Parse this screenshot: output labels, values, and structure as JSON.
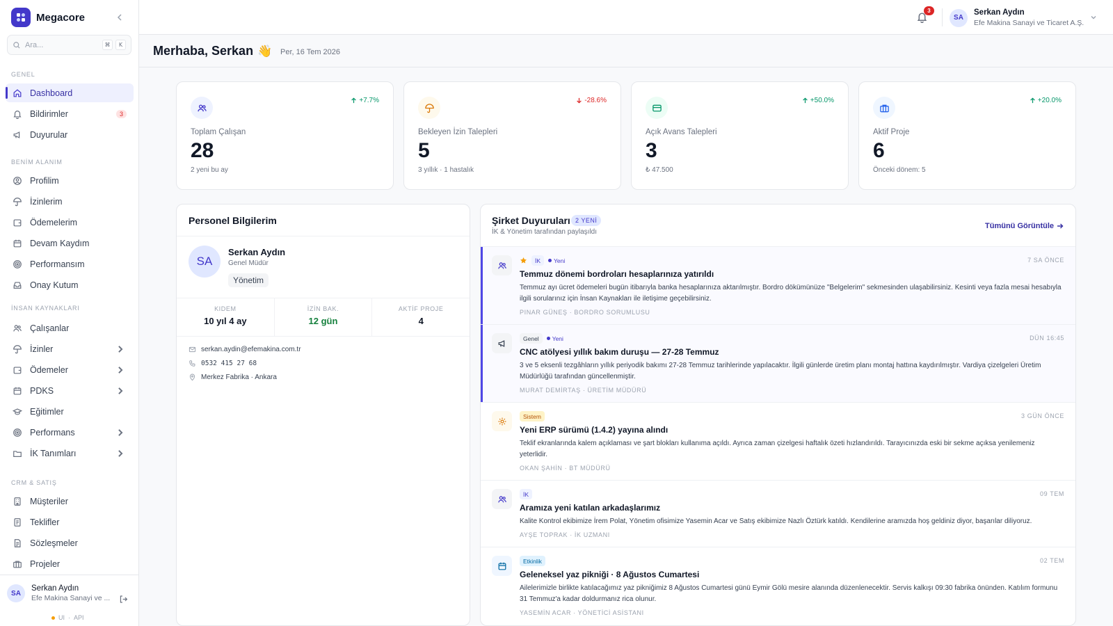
{
  "app": {
    "name": "Megacore"
  },
  "search": {
    "placeholder": "Ara...",
    "kbd1": "⌘",
    "kbd2": "K"
  },
  "sidebar": {
    "sections": [
      {
        "label": "GENEL"
      },
      {
        "label": "BENİM ALANIM"
      },
      {
        "label": "İNSAN KAYNAKLARI"
      },
      {
        "label": "CRM & SATIŞ"
      }
    ],
    "items": [
      {
        "label": "Dashboard",
        "icon": "home-icon",
        "active": true
      },
      {
        "label": "Bildirimler",
        "icon": "bell-icon",
        "badge": "3"
      },
      {
        "label": "Duyurular",
        "icon": "megaphone-icon"
      },
      {
        "label": "Profilim",
        "icon": "user-circle-icon"
      },
      {
        "label": "İzinlerim",
        "icon": "umbrella-icon"
      },
      {
        "label": "Ödemelerim",
        "icon": "wallet-icon"
      },
      {
        "label": "Devam Kaydım",
        "icon": "calendar-icon"
      },
      {
        "label": "Performansım",
        "icon": "target-icon"
      },
      {
        "label": "Onay Kutum",
        "icon": "inbox-icon"
      },
      {
        "label": "Çalışanlar",
        "icon": "users-icon"
      },
      {
        "label": "İzinler",
        "icon": "umbrella-icon",
        "chevron": true
      },
      {
        "label": "Ödemeler",
        "icon": "wallet-icon",
        "chevron": true
      },
      {
        "label": "PDKS",
        "icon": "calendar-icon",
        "chevron": true
      },
      {
        "label": "Eğitimler",
        "icon": "graduation-cap-icon"
      },
      {
        "label": "Performans",
        "icon": "target-icon",
        "chevron": true
      },
      {
        "label": "İK Tanımları",
        "icon": "folder-icon",
        "chevron": true
      },
      {
        "label": "Müşteriler",
        "icon": "building-icon"
      },
      {
        "label": "Teklifler",
        "icon": "document-icon"
      },
      {
        "label": "Sözleşmeler",
        "icon": "contract-icon"
      },
      {
        "label": "Projeler",
        "icon": "briefcase-icon"
      }
    ],
    "footer": {
      "initials": "SA",
      "name": "Serkan Aydın",
      "company": "Efe Makina Sanayi ve ...",
      "env_ui": "UI",
      "env_sep": "·",
      "env_api": "API"
    }
  },
  "topbar": {
    "notification_count": "3",
    "user_initials": "SA",
    "user_name": "Serkan Aydın",
    "user_company": "Efe Makina Sanayi ve Ticaret A.Ş."
  },
  "header": {
    "greeting": "Merhaba, Serkan",
    "emoji": "👋",
    "date": "Per, 16 Tem 2026"
  },
  "stats": [
    {
      "label": "Toplam Çalışan",
      "value": "28",
      "sub": "2 yeni bu ay",
      "trend": "+7.7%",
      "direction": "up",
      "icon": "users-icon",
      "color": "#4338ca",
      "bg": "#eef2ff"
    },
    {
      "label": "Bekleyen İzin Talepleri",
      "value": "5",
      "sub": "3 yıllık · 1 hastalık",
      "trend": "-28.6%",
      "direction": "down",
      "icon": "umbrella-icon",
      "color": "#d97706",
      "bg": "#fef9ec"
    },
    {
      "label": "Açık Avans Talepleri",
      "value": "3",
      "sub": "₺ 47.500",
      "trend": "+50.0%",
      "direction": "up",
      "icon": "credit-card-icon",
      "color": "#059669",
      "bg": "#ecfdf5"
    },
    {
      "label": "Aktif Proje",
      "value": "6",
      "sub": "Önceki dönem: 5",
      "trend": "+20.0%",
      "direction": "up",
      "icon": "briefcase-icon",
      "color": "#2563eb",
      "bg": "#eff6ff"
    }
  ],
  "profile": {
    "title": "Personel Bilgilerim",
    "initials": "SA",
    "name": "Serkan Aydın",
    "role": "Genel Müdür",
    "department": "Yönetim",
    "stats": [
      {
        "label": "KIDEM",
        "value": "10 yıl 4 ay"
      },
      {
        "label": "İZİN BAK.",
        "value": "12 gün"
      },
      {
        "label": "AKTİF PROJE",
        "value": "4"
      }
    ],
    "email": "serkan.aydin@efemakina.com.tr",
    "phone": "0532 415 27 68",
    "location": "Merkez Fabrika · Ankara"
  },
  "announcements": {
    "title": "Şirket Duyuruları",
    "new_badge": "2 YENİ",
    "subtitle": "İK & Yönetim tarafından paylaşıldı",
    "view_all": "Tümünü Görüntüle",
    "items": [
      {
        "tag": "İK",
        "new": "Yeni",
        "pinned": true,
        "time": "7 SA ÖNCE",
        "title": "Temmuz dönemi bordroları hesaplarınıza yatırıldı",
        "body": "Temmuz ayı ücret ödemeleri bugün itibarıyla banka hesaplarınıza aktarılmıştır. Bordro dökümünüze \"Belgelerim\" sekmesinden ulaşabilirsiniz. Kesinti veya fazla mesai hesabıyla ilgili sorularınız için İnsan Kaynakları ile iletişime geçebilirsiniz.",
        "author": "PINAR GÜNEŞ · BORDRO SORUMLUSU",
        "icon": "users-icon"
      },
      {
        "tag": "Genel",
        "new": "Yeni",
        "time": "DÜN 16:45",
        "title": "CNC atölyesi yıllık bakım duruşu — 27-28 Temmuz",
        "body": "3 ve 5 eksenli tezgâhların yıllık periyodik bakımı 27-28 Temmuz tarihlerinde yapılacaktır. İlgili günlerde üretim planı montaj hattına kaydırılmıştır. Vardiya çizelgeleri Üretim Müdürlüğü tarafından güncellenmiştir.",
        "author": "MURAT DEMİRTAŞ · ÜRETİM MÜDÜRÜ",
        "icon": "megaphone-icon"
      },
      {
        "tag": "Sistem",
        "time": "3 GÜN ÖNCE",
        "title": "Yeni ERP sürümü (1.4.2) yayına alındı",
        "body": "Teklif ekranlarında kalem açıklaması ve şart blokları kullanıma açıldı. Ayrıca zaman çizelgesi haftalık özeti hızlandırıldı. Tarayıcınızda eski bir sekme açıksa yenilemeniz yeterlidir.",
        "author": "OKAN ŞAHİN · BT MÜDÜRÜ",
        "icon": "gear-icon"
      },
      {
        "tag": "İK",
        "time": "09 TEM",
        "title": "Aramıza yeni katılan arkadaşlarımız",
        "body": "Kalite Kontrol ekibimize İrem Polat, Yönetim ofisimize Yasemin Acar ve Satış ekibimize Nazlı Öztürk katıldı. Kendilerine aramızda hoş geldiniz diyor, başarılar diliyoruz.",
        "author": "AYŞE TOPRAK · İK UZMANI",
        "icon": "users-icon"
      },
      {
        "tag": "Etkinlik",
        "time": "02 TEM",
        "title": "Geleneksel yaz pikniği · 8 Ağustos Cumartesi",
        "body": "Ailelerimizle birlikte katılacağımız yaz pikniğimiz 8 Ağustos Cumartesi günü Eymir Gölü mesire alanında düzenlenecektir. Servis kalkışı 09:30 fabrika önünden. Katılım formunu 31 Temmuz'a kadar doldurmanız rica olunur.",
        "author": "YASEMİN ACAR · YÖNETİCİ ASİSTANI",
        "icon": "calendar-icon"
      }
    ]
  }
}
